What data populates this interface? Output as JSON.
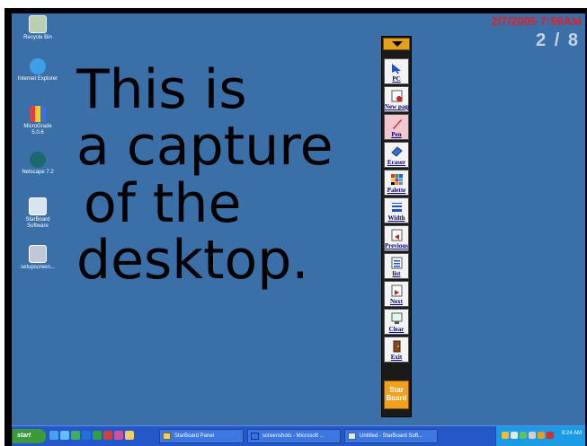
{
  "desktop": {
    "icons": [
      {
        "label": "Recycle Bin"
      },
      {
        "label": "Internet Explorer"
      },
      {
        "label": "MicroGrade 5.0.6"
      },
      {
        "label": "Netscape 7.2"
      },
      {
        "label": "StarBoard Software"
      },
      {
        "label": "setupscreen..."
      }
    ],
    "handwriting": {
      "line1": "This is",
      "line2": "a capture",
      "line3": "of the",
      "line4": "desktop."
    },
    "datetime": "2/7/2005 7:59AM",
    "page_indicator": "2 / 8"
  },
  "toolbar": {
    "tools": [
      {
        "label": "PC"
      },
      {
        "label": "New page"
      },
      {
        "label": "Pen"
      },
      {
        "label": "Eraser"
      },
      {
        "label": "Palette"
      },
      {
        "label": "Width"
      },
      {
        "label": "Previous"
      },
      {
        "label": "list"
      },
      {
        "label": "Next"
      },
      {
        "label": "Clear"
      },
      {
        "label": "Exit"
      }
    ],
    "logo_line1": "Star",
    "logo_line2": "Board"
  },
  "taskbar": {
    "start_label": "start",
    "tasks": [
      {
        "label": "StarBoard Panel"
      },
      {
        "label": "screenshots - Microsoft ..."
      },
      {
        "label": "Untitled - StarBoard Soft..."
      }
    ],
    "clock": "8:24 AM"
  },
  "colors": {
    "desktop_bg": "#3b6fa8",
    "datetime": "#e0202a",
    "taskbar": "#2458c8",
    "selected_tool": "#f2c8cf"
  }
}
